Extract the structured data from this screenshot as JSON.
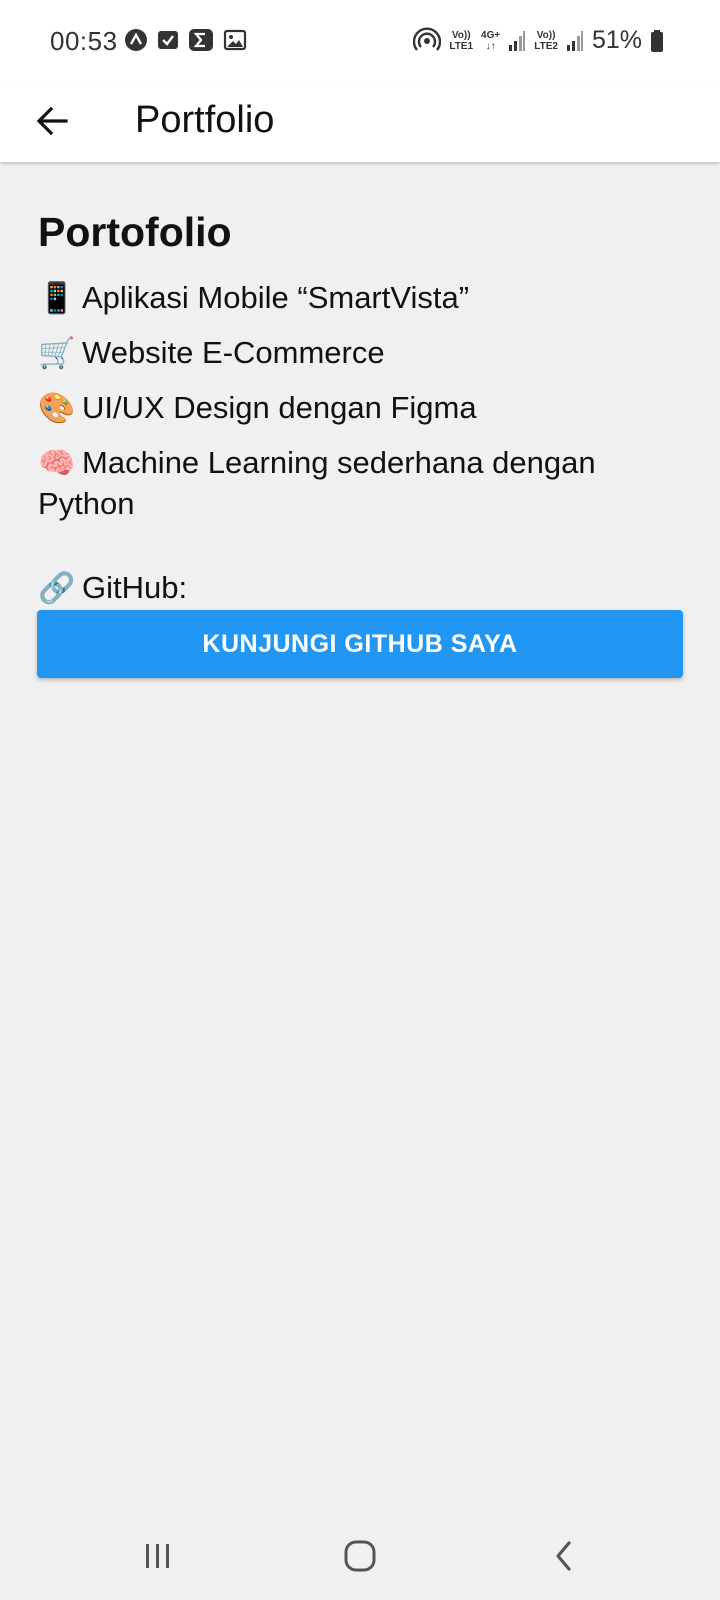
{
  "status_bar": {
    "time": "00:53",
    "battery_percent": "51%",
    "sim1": {
      "top": "Vo))",
      "bottom": "LTE1"
    },
    "network": {
      "top": "4G+",
      "bottom": "↓↑"
    },
    "sim2": {
      "top": "Vo))",
      "bottom": "LTE2"
    },
    "left_icons": [
      "notification-a-icon",
      "checkbox-icon",
      "sigma-icon",
      "image-icon"
    ],
    "right_icons": [
      "hotspot-icon",
      "signal-icon",
      "battery-icon"
    ]
  },
  "app_bar": {
    "title": "Portfolio",
    "back_icon": "arrow-left-icon"
  },
  "content": {
    "heading": "Portofolio",
    "items": [
      {
        "emoji": "📱",
        "text": "Aplikasi Mobile “SmartVista”"
      },
      {
        "emoji": "🛒",
        "text": "Website E-Commerce"
      },
      {
        "emoji": "🎨",
        "text": "UI/UX Design dengan Figma"
      },
      {
        "emoji": "🧠",
        "text": "Machine Learning sederhana dengan Python"
      }
    ],
    "github_emoji": "🔗",
    "github_label": "GitHub:",
    "github_button": "KUNJUNGI GITHUB SAYA"
  },
  "colors": {
    "accent": "#2196f3",
    "background": "#f0f0f0",
    "surface": "#ffffff"
  },
  "nav_bar": {
    "icons": [
      "recent-apps-icon",
      "home-icon",
      "back-icon"
    ]
  }
}
